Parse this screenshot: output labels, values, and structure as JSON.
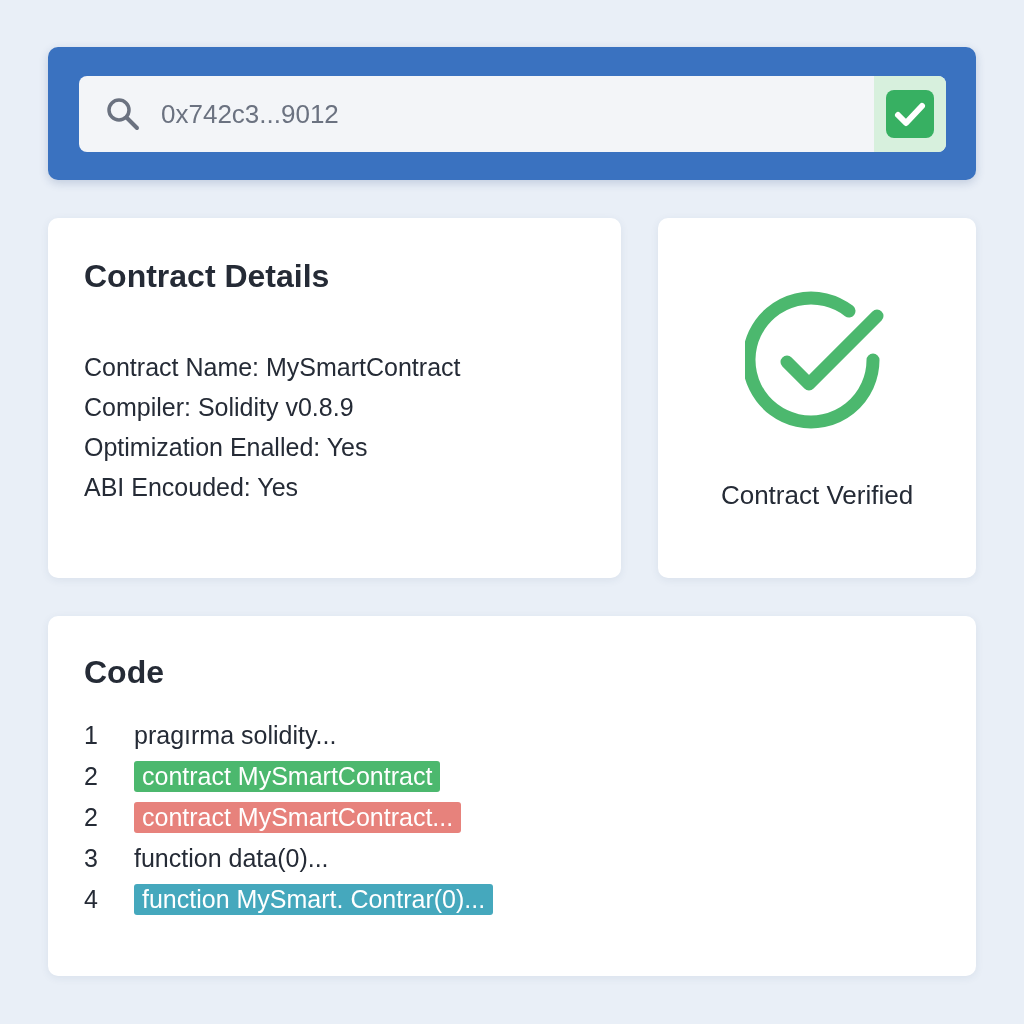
{
  "search": {
    "value": "0x742c3...9012",
    "verified": true
  },
  "details": {
    "title": "Contract Details",
    "lines": [
      "Contract Name: MySmartContract",
      "Compiler: Solidity v0.8.9",
      "Optimization Enalled: Yes",
      "ABI Encouded: Yes"
    ]
  },
  "status": {
    "verified": true,
    "label": "Contract Verified"
  },
  "code": {
    "title": "Code",
    "lines": [
      {
        "number": "1",
        "text": "pragırma solidity...",
        "kind": "plain"
      },
      {
        "number": "2",
        "text": "contract MySmartContract",
        "kind": "highlight",
        "color": "#4cb86e"
      },
      {
        "number": "2",
        "text": "contract MySmartContract...",
        "kind": "highlight",
        "color": "#e7827c"
      },
      {
        "number": "3",
        "text": "function data(0)...",
        "kind": "plain"
      },
      {
        "number": "4",
        "text": "function MySmart. Contrar(0)...",
        "kind": "highlight",
        "color": "#45a8bd"
      }
    ]
  }
}
